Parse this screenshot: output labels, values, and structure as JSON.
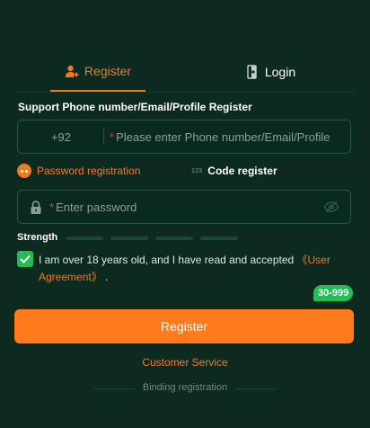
{
  "tabs": [
    {
      "label": "Register",
      "icon": "add-user-icon",
      "active": true
    },
    {
      "label": "Login",
      "icon": "door-login-icon",
      "active": false
    }
  ],
  "form": {
    "section_label": "Support Phone number/Email/Profile Register",
    "country_code": "+92",
    "account_required_mark": "*",
    "account_placeholder": "Please enter Phone number/Email/Profile",
    "password_required_mark": "*",
    "password_placeholder": "Enter password",
    "strength_label": "Strength",
    "strength_level": 0
  },
  "modes": {
    "password_label": "Password registration",
    "code_icon_text": "123",
    "code_label": "Code register"
  },
  "agreement": {
    "checked": true,
    "text": "I am over 18 years old, and I have read and accepted ",
    "link": "《User Agreement》",
    "suffix": " ."
  },
  "badge": "30-999",
  "register_button": "Register",
  "customer_service": "Customer Service",
  "binding_registration": "Binding registration",
  "colors": {
    "background": "#0c2a1f",
    "accent": "#f07a23",
    "button": "#ff7a1c",
    "success": "#1fbf55"
  }
}
